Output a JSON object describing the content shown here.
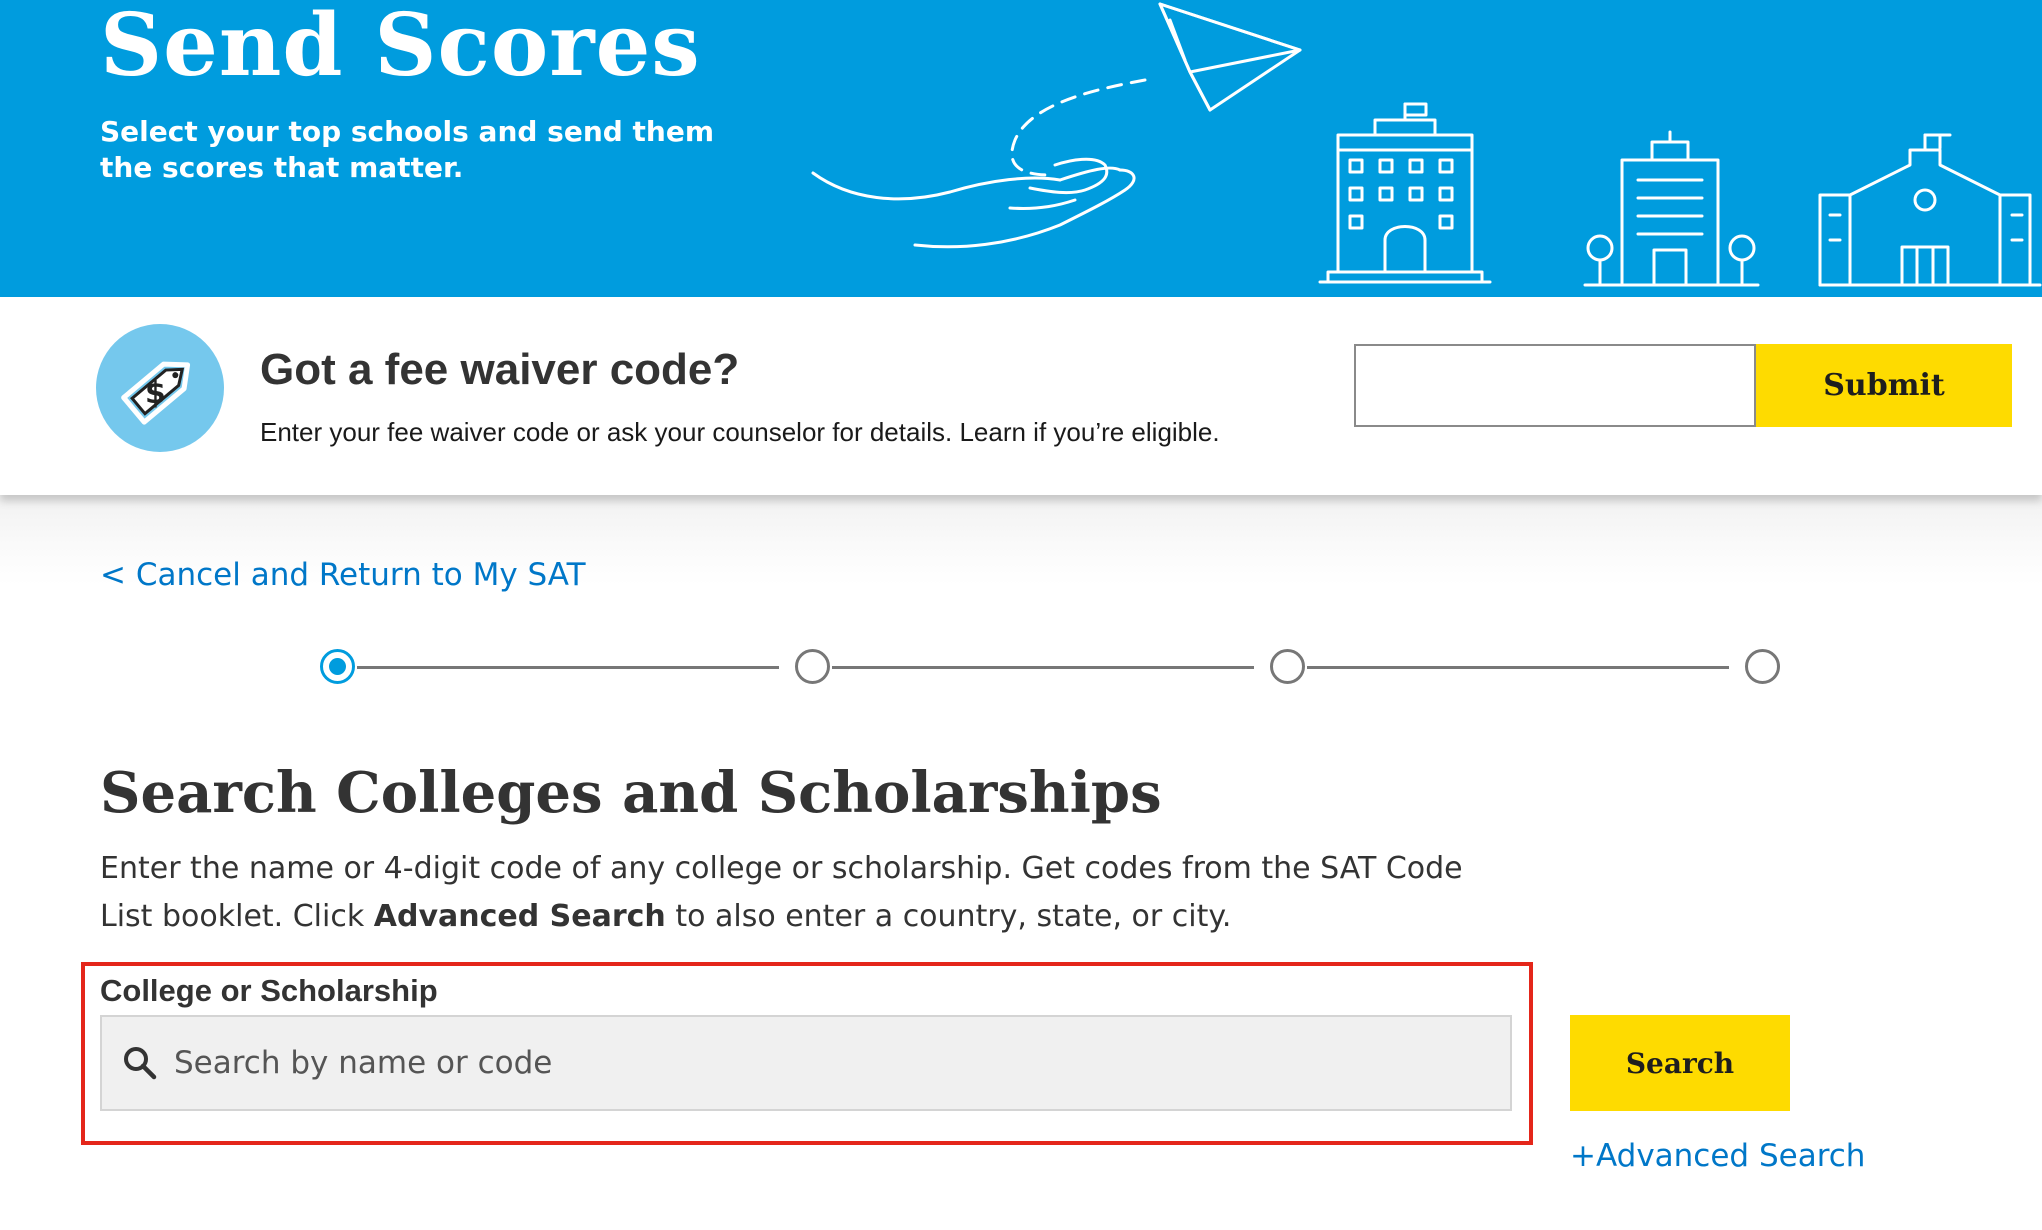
{
  "hero": {
    "title": "Send Scores",
    "subtitle": "Select your top schools and send them the scores that matter."
  },
  "fee_waiver": {
    "icon": "price-tag-dollar-icon",
    "title": "Got a fee waiver code?",
    "description": "Enter your fee waiver code or ask your counselor for details. Learn if you’re eligible.",
    "input_value": "",
    "submit_label": "Submit"
  },
  "nav": {
    "cancel_link": "< Cancel and Return to My SAT"
  },
  "stepper": {
    "total_steps": 4,
    "current_step": 1
  },
  "search_section": {
    "title": "Search Colleges and Scholarships",
    "description_part1": "Enter the name or 4-digit code of any college or scholarship. Get codes from the SAT Code List booklet. Click ",
    "description_bold": "Advanced Search",
    "description_part2": " to also enter a country, state, or city.",
    "field_label": "College or Scholarship",
    "placeholder": "Search by name or code",
    "search_icon": "search-icon",
    "search_button": "Search",
    "advanced_link": "+Advanced Search"
  },
  "colors": {
    "brand_blue": "#009cde",
    "accent_yellow": "#fedb00",
    "link_blue": "#0077c8",
    "highlight_red": "#e4261a"
  }
}
